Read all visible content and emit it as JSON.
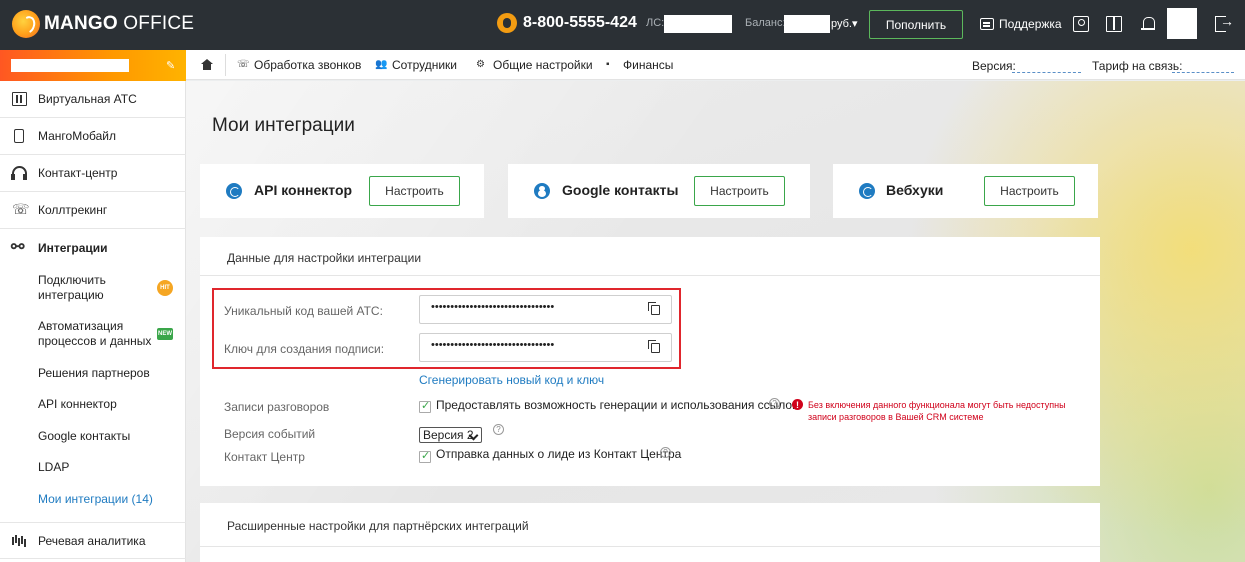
{
  "brand": {
    "name_bold": "MANGO",
    "name_rest": " OFFICE"
  },
  "header": {
    "phone": "8-800-5555-424",
    "ls_label": "ЛС:",
    "balance_label": "Баланс:",
    "balance_currency": "руб.▾",
    "topup_label": "Пополнить",
    "support_label": "Поддержка"
  },
  "sidebar": {
    "items": [
      {
        "label": "Виртуальная АТС",
        "icon": "pbx-icon"
      },
      {
        "label": "МангоМобайл",
        "icon": "mobile-icon"
      },
      {
        "label": "Контакт-центр",
        "icon": "headset-icon"
      },
      {
        "label": "Коллтрекинг",
        "icon": "calltracking-icon"
      },
      {
        "label": "Интеграции",
        "icon": "integrations-icon"
      },
      {
        "label": "Речевая аналитика",
        "icon": "speech-analytics-icon"
      }
    ],
    "sub": [
      {
        "label": "Подключить интеграцию",
        "badge": "HIT"
      },
      {
        "label": "Автоматизация процессов и данных",
        "badge": "NEW"
      },
      {
        "label": "Решения партнеров"
      },
      {
        "label": "API коннектор"
      },
      {
        "label": "Google контакты"
      },
      {
        "label": "LDAP"
      },
      {
        "label": "Мои интеграции (14)"
      }
    ]
  },
  "subnav": {
    "links": [
      "Обработка звонков",
      "Сотрудники",
      "Общие настройки",
      "Финансы"
    ],
    "version_label": "Версия:",
    "tariff_label": "Тариф на связь:"
  },
  "main": {
    "title": "Мои интеграции",
    "cards": [
      {
        "title": "API коннектор",
        "button": "Настроить"
      },
      {
        "title": "Google контакты",
        "button": "Настроить"
      },
      {
        "title": "Вебхуки",
        "button": "Настроить"
      }
    ],
    "settings": {
      "title": "Данные для настройки интеграции",
      "unique_code_label": "Уникальный код вашей АТС:",
      "unique_code_value": "••••••••••••••••••••••••••••••••",
      "sign_key_label": "Ключ для создания подписи:",
      "sign_key_value": "••••••••••••••••••••••••••••••••",
      "generate_link": "Сгенерировать новый код и ключ",
      "records_label": "Записи разговоров",
      "records_checkbox": "Предоставлять возможность генерации и использования ссылок",
      "warning": "Без включения данного функционала могут быть недоступны записи разговоров в Вашей CRM системе",
      "events_version_label": "Версия событий",
      "events_version_value": "Версия 2",
      "contact_center_label": "Контакт Центр",
      "contact_center_checkbox": "Отправка данных о лиде из Контакт Центра"
    },
    "advanced_title": "Расширенные настройки для партнёрских интеграций"
  },
  "colors": {
    "accent": "#1f7bc1",
    "success": "#3aa64a",
    "danger": "#e0262d",
    "topbar": "#2b3035"
  }
}
